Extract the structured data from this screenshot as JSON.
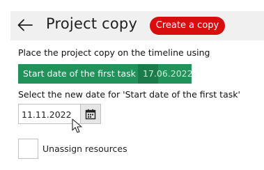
{
  "header": {
    "title": "Project copy",
    "create_button": "Create a copy"
  },
  "placement": {
    "label": "Place the project copy on the timeline using",
    "selected_option": "Start date of the first task",
    "option_date": "17.06.2022"
  },
  "new_date": {
    "label": "Select the new date for 'Start date of the first task'",
    "value": "11.11.2022"
  },
  "unassign": {
    "label": "Unassign resources",
    "checked": false
  },
  "colors": {
    "accent_red": "#d80d0d",
    "option_green": "#21925a"
  },
  "icons": {
    "back": "arrow-left-icon",
    "calendar": "calendar-icon",
    "cursor": "mouse-pointer-icon"
  }
}
